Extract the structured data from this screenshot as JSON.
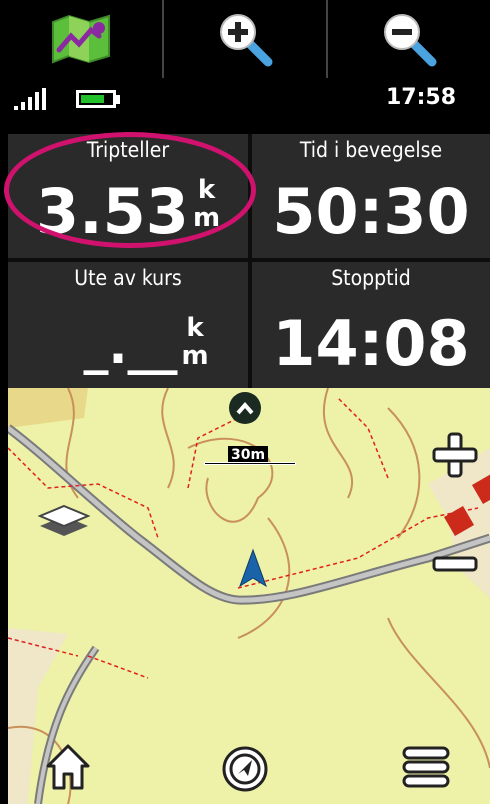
{
  "toolbar": {
    "buttons": [
      {
        "icon": "map-trail-icon"
      },
      {
        "icon": "zoom-in-icon"
      },
      {
        "icon": "zoom-out-icon"
      }
    ]
  },
  "status": {
    "time": "17:58",
    "battery_level": 0.75,
    "signal_bars": 4
  },
  "fields": [
    {
      "label": "Tripteller",
      "value": "3.53",
      "unit_top": "k",
      "unit_bottom": "m"
    },
    {
      "label": "Tid i bevegelse",
      "value": "50:30"
    },
    {
      "label": "Ute av kurs",
      "value": "_.__",
      "unit_top": "k",
      "unit_bottom": "m"
    },
    {
      "label": "Stopptid",
      "value": "14:08"
    }
  ],
  "map": {
    "scale_label": "30m",
    "colors": {
      "land": "#eef2a8",
      "road": "#b0b0b0",
      "trail": "#e02020",
      "contour": "#c8905a",
      "building": "#cc2a1a",
      "arrow": "#1a63a8"
    }
  },
  "bottom_nav": {
    "icons": [
      "home-icon",
      "navigation-icon",
      "menu-icon"
    ]
  },
  "annotation": {
    "ring_color": "#d0126e"
  }
}
